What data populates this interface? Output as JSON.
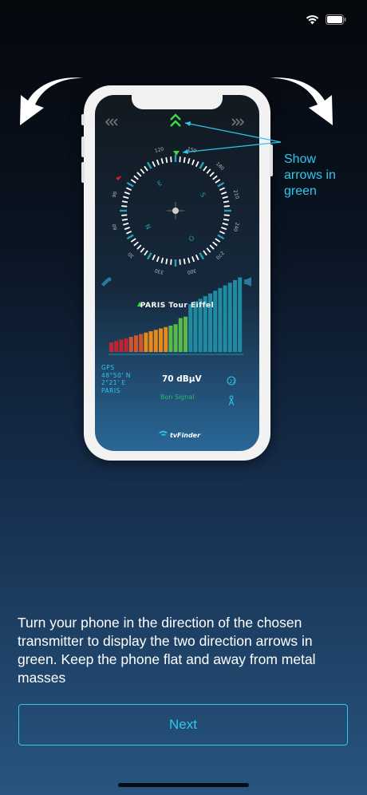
{
  "annotation": {
    "line1": "Show",
    "line2": "arrows in",
    "line3": "green"
  },
  "phone_screen": {
    "compass_numbers": [
      "120",
      "150",
      "180",
      "210",
      "240",
      "270",
      "300",
      "330",
      "30",
      "60",
      "90"
    ],
    "compass_letters": [
      "E",
      "S",
      "O",
      "N"
    ],
    "station": "PARIS Tour Eiffel",
    "gps": {
      "label": "GPS",
      "lat": "48°50' N",
      "lon": "2°21' E",
      "city": "PARIS"
    },
    "level": "70 dBµV",
    "signal_status": "Bon Signal",
    "logo": "tvFinder",
    "signal_bars": 27,
    "colors": {
      "arrows_active": "#3ddc3d",
      "bar_red": "#c0262f",
      "bar_orange": "#e8891c",
      "bar_green": "#5bb84a",
      "bar_teal": "#1f8aa0",
      "accent": "#2fc8ea"
    }
  },
  "instruction": "Turn your phone in the direction of the chosen transmitter to display the two direction arrows in green. Keep the phone flat and away from metal masses",
  "next_button": "Next"
}
